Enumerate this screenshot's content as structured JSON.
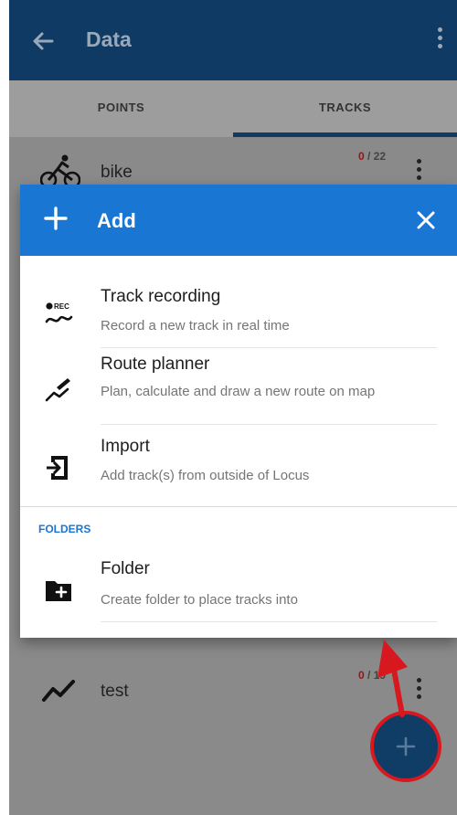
{
  "appbar": {
    "title": "Data",
    "back_icon": "arrow-back-icon",
    "more_icon": "more-vert-icon",
    "color": "#0e3a63"
  },
  "tabs": [
    {
      "label": "POINTS",
      "selected": false
    },
    {
      "label": "TRACKS",
      "selected": true
    }
  ],
  "tracks": [
    {
      "name": "bike",
      "count_done": "0",
      "count_total": "/ 22",
      "icon": "bicycle-icon"
    },
    {
      "name": "test",
      "count_done": "0",
      "count_total": "/ 19",
      "icon": "track-line-icon"
    }
  ],
  "dialog": {
    "title": "Add",
    "header_color": "#1976d2",
    "items": [
      {
        "title": "Track recording",
        "subtitle": "Record a new track in real time",
        "icon": "track-recording-icon"
      },
      {
        "title": "Route planner",
        "subtitle": "Plan, calculate and draw a new route on map",
        "icon": "route-planner-icon"
      },
      {
        "title": "Import",
        "subtitle": "Add track(s) from outside of Locus",
        "icon": "import-icon"
      }
    ],
    "folders_label": "FOLDERS",
    "folder_item": {
      "title": "Folder",
      "subtitle": "Create folder to place tracks into",
      "icon": "create-folder-icon"
    },
    "rec_badge": "REC"
  },
  "fab": {
    "icon": "plus-icon",
    "highlight_color": "#d7191f"
  }
}
